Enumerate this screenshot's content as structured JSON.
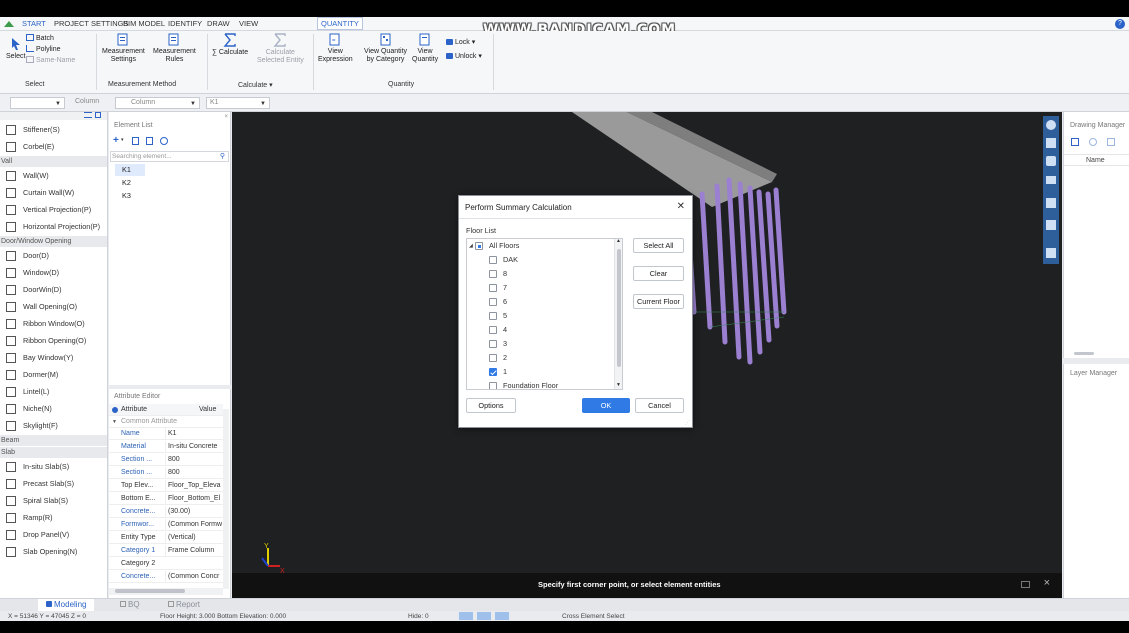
{
  "watermark": "WWW.BANDICAM.COM",
  "menu": {
    "tabs": [
      "START",
      "PROJECT SETTINGS",
      "BIM MODEL",
      "IDENTIFY",
      "DRAW",
      "VIEW",
      "QUANTITY"
    ],
    "active": "START",
    "current": "QUANTITY"
  },
  "ribbon": {
    "select": {
      "label": "Select",
      "group": "Select",
      "batch": "Batch",
      "polyline": "Polyline",
      "same_name": "Same-Name"
    },
    "measurement": {
      "settings": "Measurement Settings",
      "settings_l1": "Measurement",
      "settings_l2": "Settings",
      "rules_l1": "Measurement",
      "rules_l2": "Rules",
      "group": "Measurement Method"
    },
    "calculate": {
      "calc": "∑ Calculate",
      "calc_sel_l1": "Calculate",
      "calc_sel_l2": "Selected Entity",
      "group": "Calculate ▾"
    },
    "quantity": {
      "view_expr_l1": "View",
      "view_expr_l2": "Expression",
      "view_cat_l1": "View Quantity",
      "view_cat_l2": "by Category",
      "view_qty_l1": "View",
      "view_qty_l2": "Quantity",
      "lock": "Lock ▾",
      "unlock": "Unlock ▾",
      "group": "Quantity"
    }
  },
  "filters": {
    "column1": "Column",
    "column2": "Column",
    "k1": "K1"
  },
  "left_panel": {
    "items": [
      {
        "label": "Stiffener(S)",
        "icon": "stiffener-icon"
      },
      {
        "label": "Corbel(E)",
        "icon": "corbel-icon"
      },
      {
        "cat": "Vall"
      },
      {
        "label": "Wall(W)",
        "icon": "wall-icon"
      },
      {
        "label": "Curtain Wall(W)",
        "icon": "curtain-wall-icon"
      },
      {
        "label": "Vertical Projection(P)",
        "icon": "vertical-projection-icon"
      },
      {
        "label": "Horizontal Projection(P)",
        "icon": "horizontal-projection-icon"
      },
      {
        "cat": "Door/Window Opening"
      },
      {
        "label": "Door(D)",
        "icon": "door-icon"
      },
      {
        "label": "Window(D)",
        "icon": "window-icon"
      },
      {
        "label": "DoorWin(D)",
        "icon": "doorwin-icon"
      },
      {
        "label": "Wall Opening(O)",
        "icon": "wall-opening-icon"
      },
      {
        "label": "Ribbon Window(O)",
        "icon": "ribbon-window-icon"
      },
      {
        "label": "Ribbon Opening(O)",
        "icon": "ribbon-opening-icon"
      },
      {
        "label": "Bay Window(Y)",
        "icon": "bay-window-icon"
      },
      {
        "label": "Dormer(M)",
        "icon": "dormer-icon"
      },
      {
        "label": "Lintel(L)",
        "icon": "lintel-icon"
      },
      {
        "label": "Niche(N)",
        "icon": "niche-icon"
      },
      {
        "label": "Skylight(F)",
        "icon": "skylight-icon"
      },
      {
        "cat": "Beam"
      },
      {
        "cat": "Slab"
      },
      {
        "label": "In-situ Slab(S)",
        "icon": "insitu-slab-icon"
      },
      {
        "label": "Precast Slab(S)",
        "icon": "precast-slab-icon"
      },
      {
        "label": "Spiral Slab(S)",
        "icon": "spiral-slab-icon"
      },
      {
        "label": "Ramp(R)",
        "icon": "ramp-icon"
      },
      {
        "label": "Drop Panel(V)",
        "icon": "drop-panel-icon"
      },
      {
        "label": "Slab Opening(N)",
        "icon": "slab-opening-icon"
      }
    ]
  },
  "element_list": {
    "title": "Element List",
    "search_placeholder": "Searching element...",
    "items": [
      "K1",
      "K2",
      "K3"
    ],
    "selected": "K1"
  },
  "attribute_editor": {
    "title": "Attribute Editor",
    "col_attribute": "Attribute",
    "col_value": "Value",
    "group": "Common Attribute",
    "rows": [
      {
        "k": "Name",
        "v": "K1",
        "blue": true
      },
      {
        "k": "Material",
        "v": "In-situ Concrete",
        "blue": true
      },
      {
        "k": "Section ...",
        "v": "800",
        "blue": true
      },
      {
        "k": "Section ...",
        "v": "800",
        "blue": true
      },
      {
        "k": "Top Elev...",
        "v": "Floor_Top_Eleva",
        "blue": false
      },
      {
        "k": "Bottom E...",
        "v": "Floor_Bottom_El",
        "blue": false
      },
      {
        "k": "Concrete...",
        "v": "(30.00)",
        "blue": true
      },
      {
        "k": "Formwor...",
        "v": "(Common Formw",
        "blue": true
      },
      {
        "k": "Entity Type",
        "v": "(Vertical)",
        "blue": false
      },
      {
        "k": "Category 1",
        "v": "Frame Column",
        "blue": true
      },
      {
        "k": "Category 2",
        "v": "",
        "blue": false
      },
      {
        "k": "Concrete...",
        "v": "(Common Concr",
        "blue": true
      }
    ]
  },
  "viewport": {
    "prompt": "Specify first corner point, or select element entities"
  },
  "right_panels": {
    "drawing_manager": "Drawing Manager",
    "name_col": "Name",
    "layer_manager": "Layer Manager"
  },
  "bottom_tabs": {
    "modeling": "Modeling",
    "bq": "BQ",
    "report": "Report"
  },
  "status": {
    "coords": "X = 51346 Y = 47045 Z = 0",
    "floor_height": "Floor Height: 3.000   Bottom Elevation: 0.000",
    "hide": "Hide: 0",
    "cross": "Cross Element Select"
  },
  "dialog": {
    "title": "Perform Summary Calculation",
    "floor_list_label": "Floor List",
    "floors": [
      {
        "label": "All Floors",
        "state": "partial",
        "root": true
      },
      {
        "label": "DAK",
        "state": "unchecked"
      },
      {
        "label": "8",
        "state": "unchecked"
      },
      {
        "label": "7",
        "state": "unchecked"
      },
      {
        "label": "6",
        "state": "unchecked"
      },
      {
        "label": "5",
        "state": "unchecked"
      },
      {
        "label": "4",
        "state": "unchecked"
      },
      {
        "label": "3",
        "state": "unchecked"
      },
      {
        "label": "2",
        "state": "unchecked"
      },
      {
        "label": "1",
        "state": "checked"
      },
      {
        "label": "Foundation Floor",
        "state": "unchecked"
      }
    ],
    "buttons": {
      "select_all": "Select All",
      "clear": "Clear",
      "current_floor": "Current Floor",
      "options": "Options",
      "ok": "OK",
      "cancel": "Cancel"
    }
  },
  "colors": {
    "accent": "#2f7ae5",
    "viewport": "#1f2022",
    "column": "#9b7fd0",
    "slab": "#9a9a9a"
  }
}
